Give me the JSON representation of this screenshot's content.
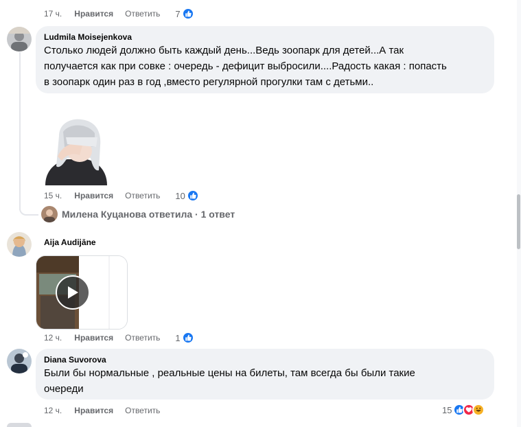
{
  "top_actions": {
    "time": "17 ч.",
    "like": "Нравится",
    "reply": "Ответить",
    "count": "7"
  },
  "comment1": {
    "author": "Ludmila Moisejenkova",
    "line1": "Столько людей должно быть каждый день...Ведь зоопарк для детей...А так",
    "line2": "получается как при совке : очередь - дефицит выбросили....Радость какая : попасть",
    "line3": "в зоопарк один раз в год ,вместо регулярной прогулки там с детьми..",
    "actions": {
      "time": "15 ч.",
      "like": "Нравится",
      "reply": "Ответить",
      "count": "10"
    }
  },
  "replies_link": "Милена Куцанова ответила · 1 ответ",
  "comment2": {
    "author": "Aija Audijāne",
    "actions": {
      "time": "12 ч.",
      "like": "Нравится",
      "reply": "Ответить",
      "count": "1"
    }
  },
  "comment3": {
    "author": "Diana Suvorova",
    "line1": "Были бы нормальные , реальные цены на билеты, там всегда бы были такие",
    "line2": "очереди",
    "actions": {
      "time": "12 ч.",
      "like": "Нравится",
      "reply": "Ответить",
      "count": "15"
    }
  },
  "colors": {
    "like_blue": "#1877f2",
    "love_red": "#f0284a",
    "haha_yellow": "#f7b125",
    "bubble_bg": "#f0f2f5",
    "meta_gray": "#65676b"
  },
  "icons": [
    "like-icon",
    "love-icon",
    "haha-icon",
    "play-icon"
  ]
}
